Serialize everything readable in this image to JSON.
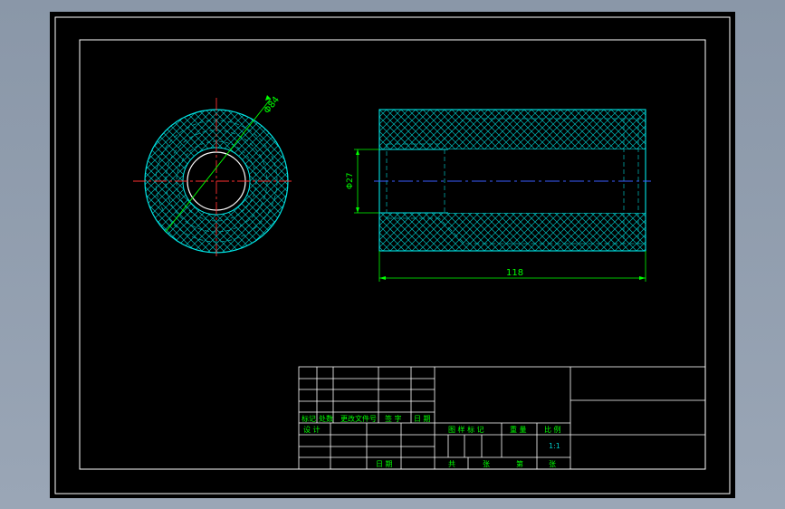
{
  "colors": {
    "background": "#000000",
    "frame": "#ffffff",
    "hatch": "#00c8c8",
    "part_outline": "#00e6e6",
    "center_line_red": "#ff3030",
    "center_line_blue": "#3a5cff",
    "dimension": "#00ff00",
    "title_text": "#00ff00"
  },
  "dimensions": {
    "outer_diameter": "Φ84",
    "bore_diameter": "Φ27",
    "length": "118"
  },
  "title_block": {
    "revision_headers": [
      "标记",
      "处数",
      "更改文件号",
      "签 字",
      "日 期"
    ],
    "design_label": "设 计",
    "date_label": "日 期",
    "stage_mark_label": "图 样 标 记",
    "weight_label": "重 量",
    "scale_label": "比 例",
    "scale_value": "1:1",
    "total_label": "共",
    "sheet_unit_1": "张",
    "sheet_label": "第",
    "sheet_unit_2": "张"
  }
}
